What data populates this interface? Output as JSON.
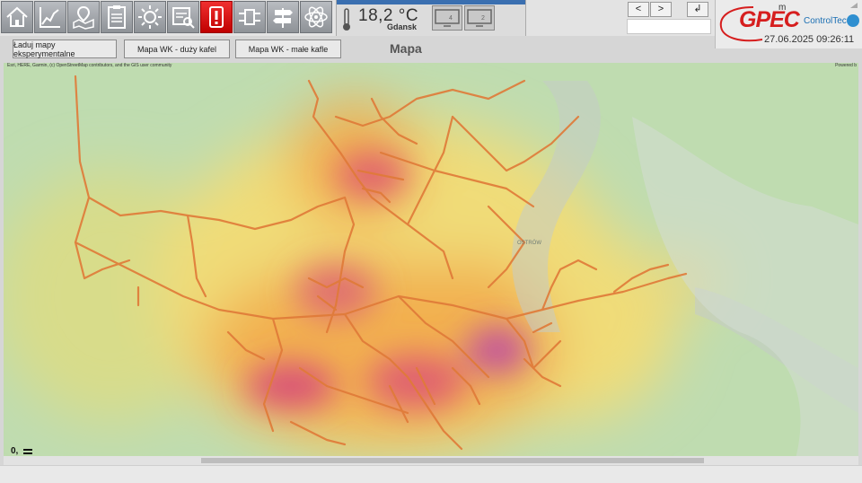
{
  "nav": {
    "buttons": [
      {
        "icon": "home-icon"
      },
      {
        "icon": "chart-icon"
      },
      {
        "icon": "map-pin-icon"
      },
      {
        "icon": "report-icon"
      },
      {
        "icon": "sun-icon"
      },
      {
        "icon": "analysis-icon"
      },
      {
        "icon": "alarm-icon",
        "active": true
      },
      {
        "icon": "network-icon"
      },
      {
        "icon": "signpost-icon"
      },
      {
        "icon": "atom-icon"
      }
    ],
    "active_color": "#e01010"
  },
  "weather": {
    "temperature": "18,2",
    "unit": "°C",
    "city": "Gdansk"
  },
  "screens": [
    {
      "label": "4"
    },
    {
      "label": "2"
    }
  ],
  "navigation": {
    "prev": "<",
    "next": ">",
    "enter": "↲"
  },
  "brand": {
    "logo": "GPEC",
    "partner": "ControlTec",
    "datetime": "27.06.2025 09:26:11",
    "user_initial": "m"
  },
  "toolbar": {
    "load_label": "Ładuj mapy eksperymentalne",
    "large_tile_label": "Mapa WK - duży kafel",
    "small_tile_label": "Mapa WK - małe kafle"
  },
  "page_title": "Mapa",
  "map": {
    "attribution": "Esri, HERE, Garmin, (c) OpenStreetMap contributors, and the GIS user community",
    "powered": "Powered b",
    "scale_label": "0,",
    "district_label": "OSTRÓW",
    "colors": {
      "network": "#e07a38",
      "hot": "#cc3b6a",
      "warm": "#f2a040",
      "mild": "#f0dc78",
      "cool": "#9fcf94",
      "water": "#c4ccc6"
    }
  }
}
